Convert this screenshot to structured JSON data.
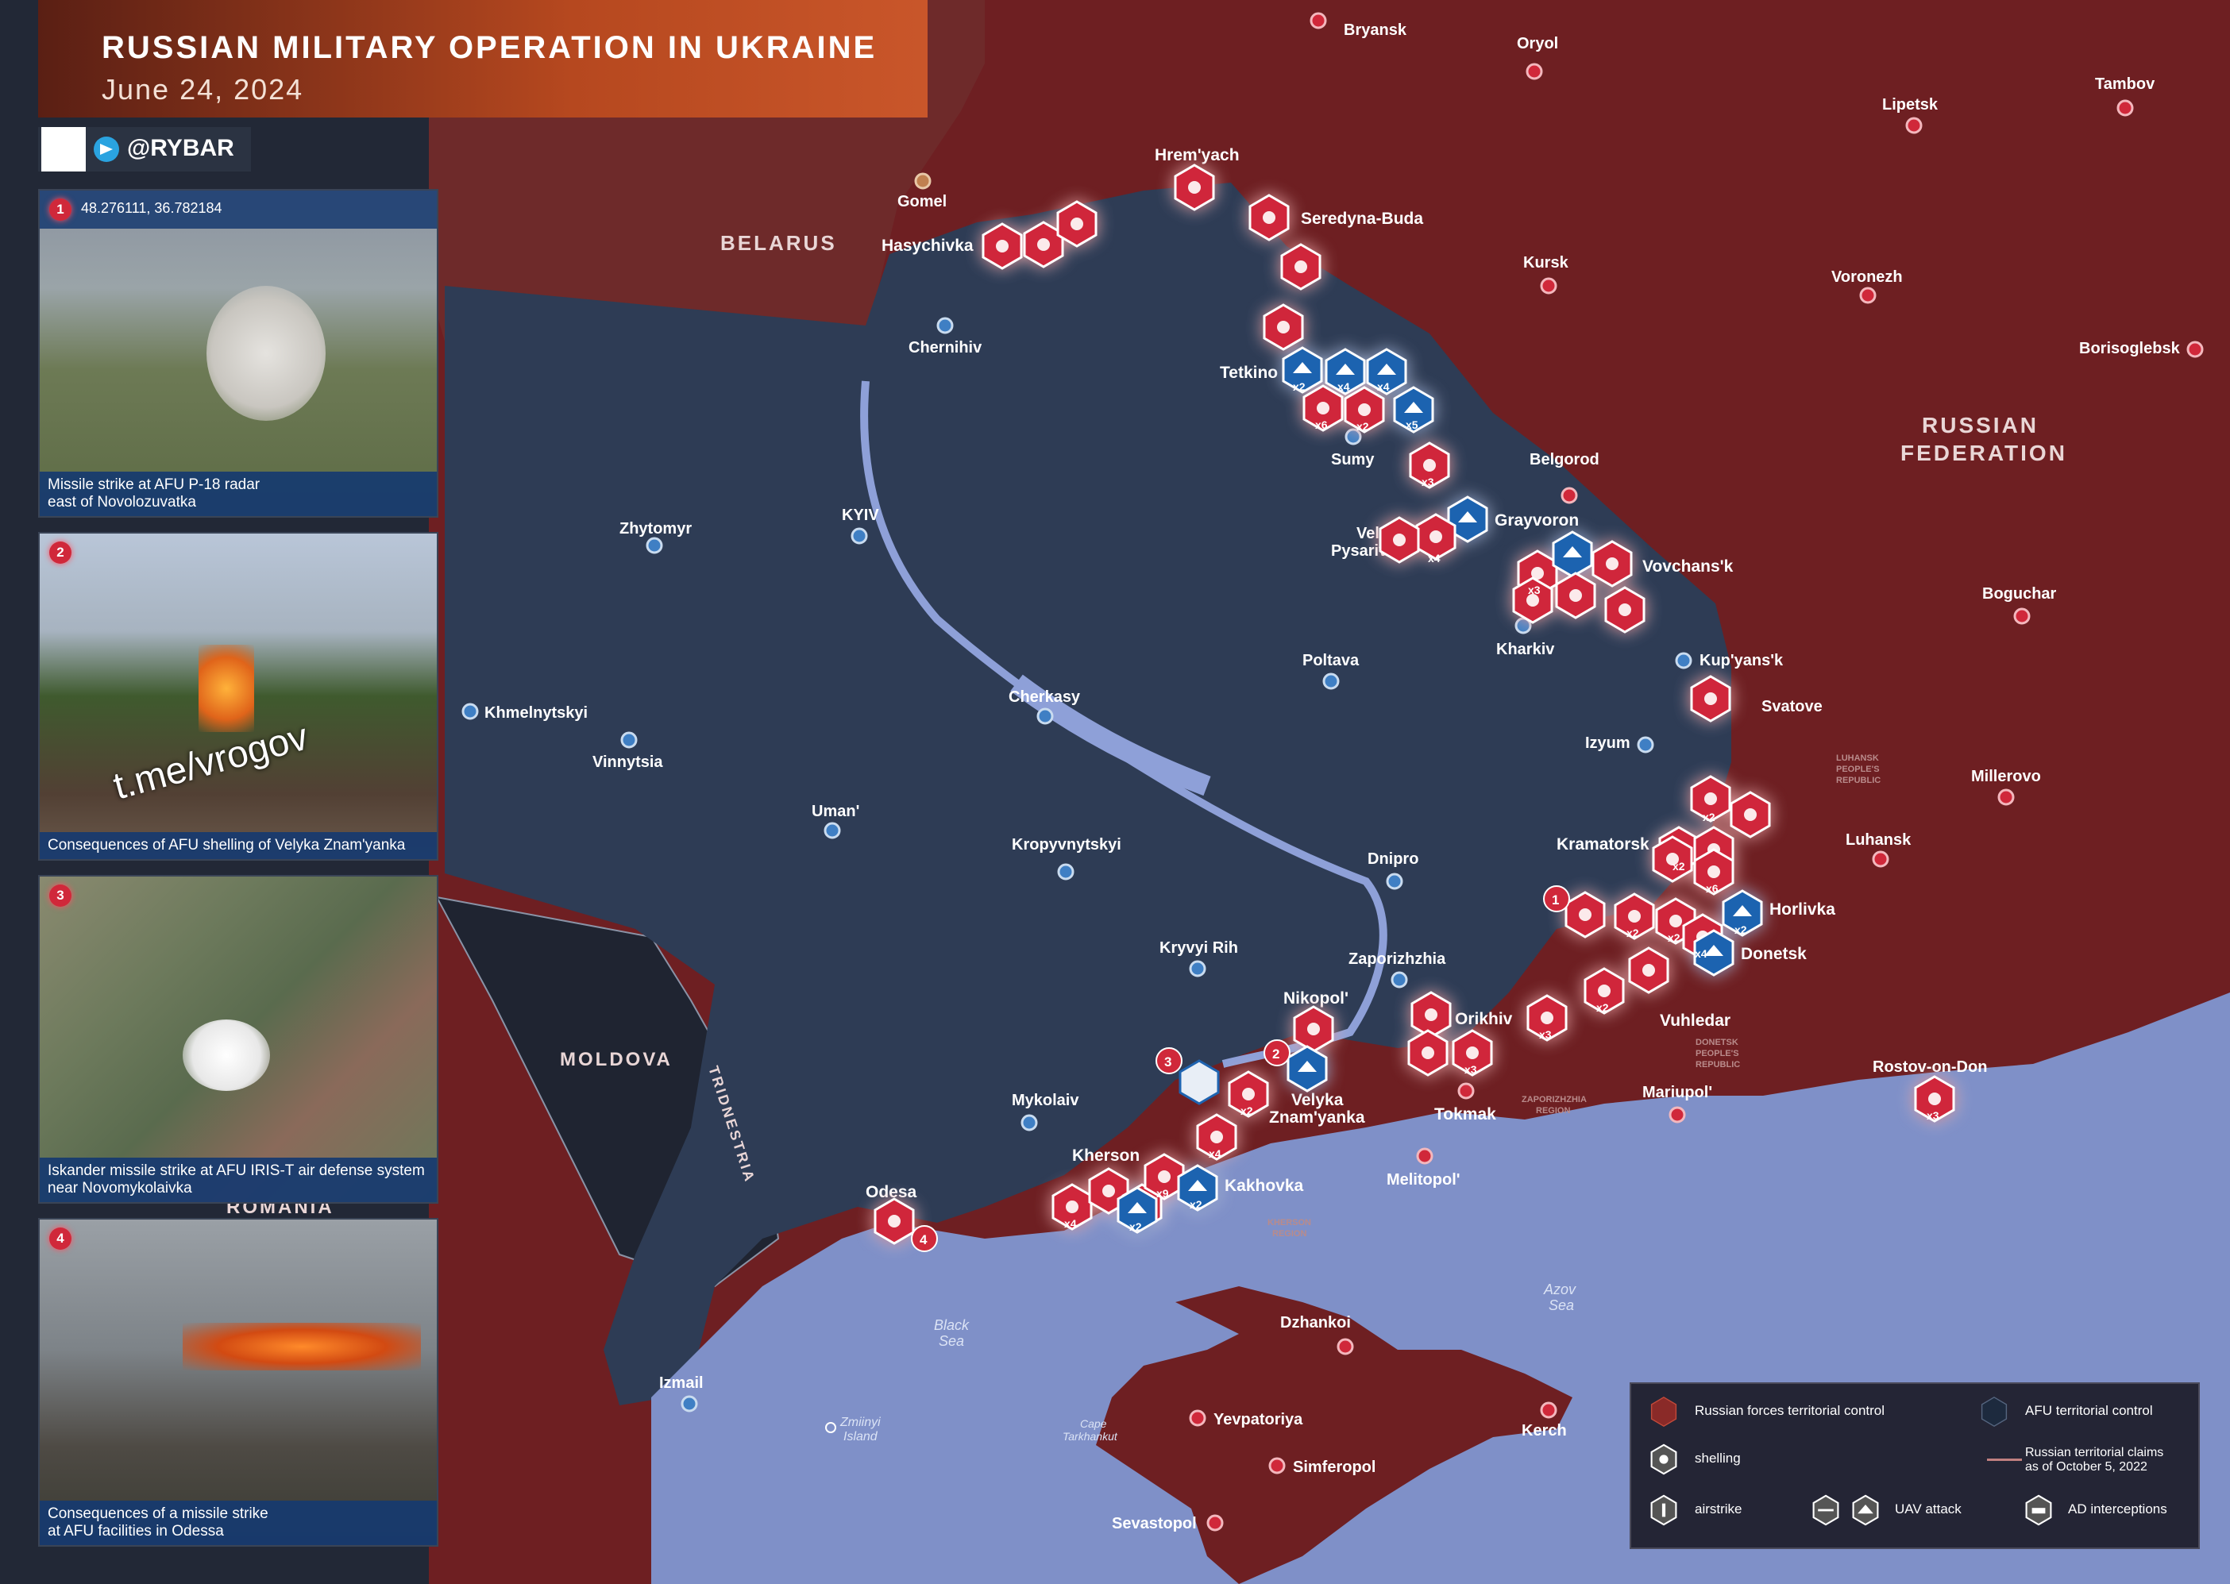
{
  "header": {
    "title": "RUSSIAN MILITARY OPERATION IN UKRAINE",
    "date": "June 24, 2024",
    "brand": "@RYBAR"
  },
  "colors": {
    "russia": "#6e1f22",
    "ukraine": "#2e3c55",
    "sea": "#7f90c8",
    "red_icon": "#d0283a",
    "blue_icon": "#1e63b0"
  },
  "country_labels": {
    "belarus": "BELARUS",
    "moldova": "MOLDOVA",
    "romania": "ROMANIA",
    "transnistria": "TRIDNESTRIA",
    "russia_line1": "RUSSIAN",
    "russia_line2": "FEDERATION"
  },
  "region_labels": {
    "luhansk_1": "LUHANSK",
    "luhansk_2": "PEOPLE'S",
    "luhansk_3": "REPUBLIC",
    "donetsk_1": "DONETSK",
    "donetsk_2": "PEOPLE'S",
    "donetsk_3": "REPUBLIC",
    "zaporizhzhia_1": "ZAPORIZHZHIA",
    "zaporizhzhia_2": "REGION",
    "kherson_1": "KHERSON",
    "kherson_2": "REGION"
  },
  "sea_labels": {
    "black_1": "Black",
    "black_2": "Sea",
    "azov_1": "Azov",
    "azov_2": "Sea",
    "zmiinyi_1": "Zmiinyi",
    "zmiinyi_2": "Island",
    "tarkhankut_1": "Cape",
    "tarkhankut_2": "Tarkhankut"
  },
  "cities": {
    "bryansk": "Bryansk",
    "oryol": "Oryol",
    "tambov": "Tambov",
    "lipetsk": "Lipetsk",
    "gomel": "Gomel",
    "hremyach": "Hrem'yach",
    "hasychivka": "Hasychivka",
    "seredyna": "Seredyna-Buda",
    "kursk": "Kursk",
    "voronezh": "Voronezh",
    "borisoglebsk": "Borisoglebsk",
    "chernihiv": "Chernihiv",
    "tetkino": "Tetkino",
    "sumy": "Sumy",
    "belgorod": "Belgorod",
    "kyiv": "KYIV",
    "zhytomyr": "Zhytomyr",
    "grayvoron": "Grayvoron",
    "velyka_pys_1": "Velyka",
    "velyka_pys_2": "Pysarivka",
    "vovchansk": "Vovchans'k",
    "boguchar": "Boguchar",
    "kharkiv": "Kharkiv",
    "poltava": "Poltava",
    "kupyansk": "Kup'yans'k",
    "svatove": "Svatove",
    "khmelnytskyi": "Khmelnytskyi",
    "cherkasy": "Cherkasy",
    "vinnytsia": "Vinnytsia",
    "izyum": "Izyum",
    "millerovo": "Millerovo",
    "uman": "Uman'",
    "kramatorsk": "Kramatorsk",
    "luhansk": "Luhansk",
    "kropyvnytskyi": "Kropyvnytskyi",
    "dnipro": "Dnipro",
    "horlivka": "Horlivka",
    "donetsk": "Donetsk",
    "kryvyi_rih": "Kryvyi Rih",
    "zaporizhzhia": "Zaporizhzhia",
    "vuhledar": "Vuhledar",
    "nikopol": "Nikopol'",
    "orikhiv": "Orikhiv",
    "rostov": "Rostov-on-Don",
    "velyka_zn_1": "Velyka",
    "velyka_zn_2": "Znam'yanka",
    "mykolaiv": "Mykolaiv",
    "tokmak": "Tokmak",
    "mariupol": "Mariupol'",
    "kherson": "Kherson",
    "kakhovka": "Kakhovka",
    "melitopol": "Melitopol'",
    "odesa": "Odesa",
    "dzhankoi": "Dzhankoi",
    "izmail": "Izmail",
    "yevpatoriya": "Yevpatoriya",
    "kerch": "Kerch",
    "simferopol": "Simferopol",
    "sevastopol": "Sevastopol"
  },
  "panels": [
    {
      "num": "1",
      "coords": "48.276111, 36.782184",
      "caption_1": "Missile strike at AFU P-18 radar",
      "caption_2": "east of Novolozuvatka"
    },
    {
      "num": "2",
      "caption_1": "Consequences of AFU shelling of Velyka Znam'yanka",
      "watermark": "t.me/vrogov"
    },
    {
      "num": "3",
      "caption_1": "Iskander missile strike at AFU IRIS-T air defense system",
      "caption_2": "near Novomykolaivka"
    },
    {
      "num": "4",
      "caption_1": "Consequences of a missile strike",
      "caption_2": "at AFU facilities in Odessa"
    }
  ],
  "map_badges": [
    "1",
    "2",
    "3",
    "4"
  ],
  "multipliers": {
    "tetkino_1": "x2",
    "tetkino_2": "x4",
    "tetkino_3": "x4",
    "tetkino_4": "x6",
    "tetkino_5": "x2",
    "tetkino_6": "x5",
    "sumy_1": "x3",
    "velyka_1": "x4",
    "vovchansk_1": "x3",
    "kramatorsk_1": "x2",
    "kramatorsk_2": "x2",
    "kramatorsk_3": "x6",
    "horlivka_1": "x2",
    "donetsk_1": "x2",
    "donetsk_2": "x2",
    "donetsk_3": "x4",
    "donetsk_4": "x2",
    "orikhiv_1": "x3",
    "orikhiv_2": "x3",
    "nikopol_1": "x2",
    "kherson_1": "x4",
    "kherson_2": "x9",
    "kherson_3": "x4",
    "kherson_4": "x2",
    "kherson_5": "x2",
    "rostov_1": "x3"
  },
  "legend": {
    "russian_control": "Russian forces territorial control",
    "afu_control": "AFU territorial control",
    "shelling": "shelling",
    "claims_1": "Russian territorial claims",
    "claims_2": "as of October 5, 2022",
    "airstrike": "airstrike",
    "uav": "UAV attack",
    "ad": "AD interceptions"
  }
}
